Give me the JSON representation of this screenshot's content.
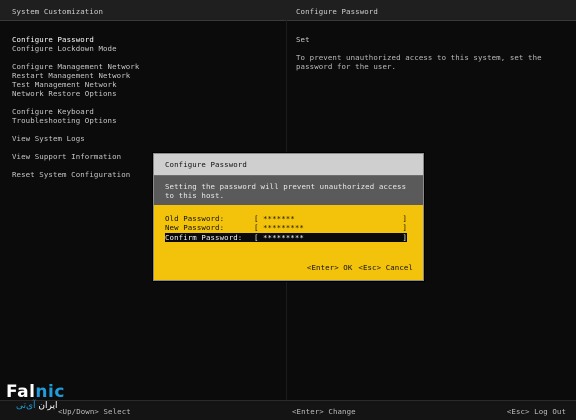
{
  "header": {
    "left_title": "System Customization",
    "right_title": "Configure Password"
  },
  "menu": {
    "groups": [
      {
        "items": [
          "Configure Password",
          "Configure Lockdown Mode"
        ]
      },
      {
        "items": [
          "Configure Management Network",
          "Restart Management Network",
          "Test Management Network",
          "Network Restore Options"
        ]
      },
      {
        "items": [
          "Configure Keyboard",
          "Troubleshooting Options"
        ]
      },
      {
        "items": [
          "View System Logs"
        ]
      },
      {
        "items": [
          "View Support Information"
        ]
      },
      {
        "items": [
          "Reset System Configuration"
        ]
      }
    ]
  },
  "right_panel": {
    "status": "Set",
    "description": "To prevent unauthorized access to this system, set the password for the user."
  },
  "dialog": {
    "title": "Configure Password",
    "description": "Setting the password will prevent unauthorized access to this host.",
    "fields": [
      {
        "label": "Old Password:",
        "open": "[",
        "value": "*******",
        "close": "]"
      },
      {
        "label": "New Password:",
        "open": "[",
        "value": "*********",
        "close": "]"
      },
      {
        "label": "Confirm Password:",
        "open": "[",
        "value": "*********",
        "close": "]"
      }
    ],
    "ok_label": "<Enter> OK",
    "cancel_label": "<Esc> Cancel"
  },
  "footer": {
    "left_hint": "<Up/Down> Select",
    "mid_hint": "<Enter> Change",
    "right_hint": "<Esc> Log Out"
  },
  "logo": {
    "brand_prefix": "Fal",
    "brand_accent": "nic",
    "subtitle_prefix": "ایران ",
    "subtitle_accent": "آی‌تی"
  },
  "colors": {
    "dialog_background": "#f3c20a",
    "dialog_title_background": "#cfcfcf",
    "dialog_desc_background": "#5a5a5a",
    "logo_accent": "#1f9cd9"
  }
}
